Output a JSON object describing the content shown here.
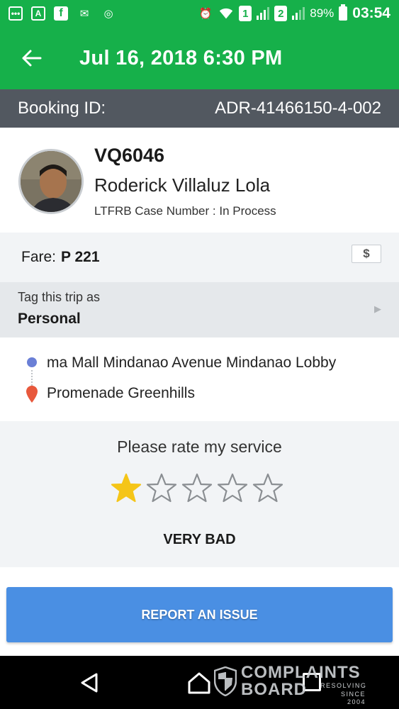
{
  "status_bar": {
    "battery": "89%",
    "time": "03:54",
    "sim1": "1",
    "sim2": "2"
  },
  "header": {
    "title": "Jul 16, 2018 6:30 PM"
  },
  "booking": {
    "label": "Booking ID:",
    "id": "ADR-41466150-4-002"
  },
  "driver": {
    "plate": "VQ6046",
    "name": "Roderick Villaluz Lola",
    "ltfrb": "LTFRB Case Number : In Process"
  },
  "fare": {
    "label": "Fare:",
    "value": "P 221",
    "payment_icon": "$"
  },
  "tag": {
    "label": "Tag this trip as",
    "value": "Personal"
  },
  "route": {
    "pickup": "ma Mall Mindanao Avenue Mindanao Lobby",
    "dropoff": "Promenade Greenhills"
  },
  "rating": {
    "title": "Please rate my service",
    "stars": 1,
    "max": 5,
    "label": "VERY BAD",
    "filled_color": "#f5c518"
  },
  "report_button": {
    "label": "REPORT AN ISSUE"
  },
  "watermark": {
    "line1": "COMPLAINTS",
    "line2": "BOARD",
    "sub1": "RESOLVING",
    "sub2": "SINCE 2004"
  },
  "colors": {
    "brand": "#16b04a",
    "booking_bar": "#525860",
    "report": "#4a8fe3"
  }
}
